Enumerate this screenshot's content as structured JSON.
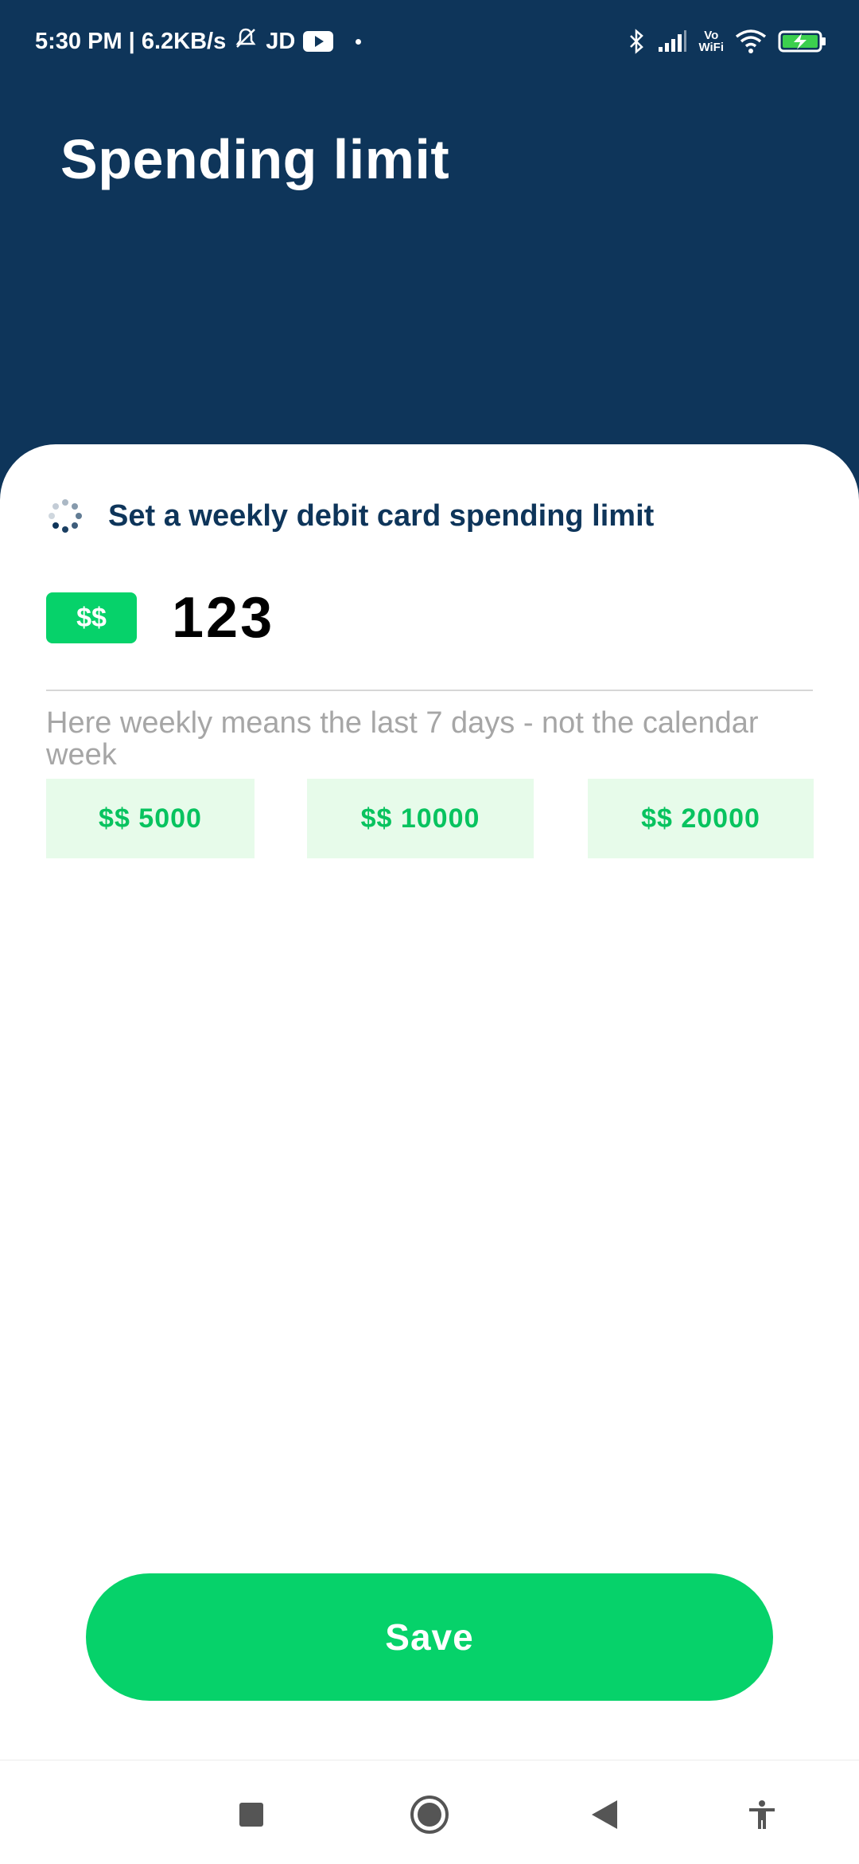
{
  "status_bar": {
    "time_and_speed": "5:30 PM | 6.2KB/s",
    "carrier_tag": "JD",
    "vowifi_top": "Vo",
    "vowifi_bottom": "WiFi"
  },
  "header": {
    "title": "Spending limit"
  },
  "card": {
    "heading": "Set a weekly debit card spending limit",
    "currency_badge": "$$",
    "amount_value": "123",
    "hint": "Here weekly means the last 7 days - not the calendar week",
    "presets": [
      {
        "label": "$$ 5000"
      },
      {
        "label": "$$ 10000"
      },
      {
        "label": "$$ 20000"
      }
    ]
  },
  "actions": {
    "save_label": "Save"
  },
  "colors": {
    "header_bg": "#0e355a",
    "accent_green": "#06d26a",
    "preset_bg": "#e7fbea",
    "hint_text": "#a6a6a6"
  },
  "icons": {
    "heading_icon": "loading-spinner-icon",
    "nav": [
      "recents-square-icon",
      "home-circle-icon",
      "back-triangle-icon",
      "accessibility-icon"
    ]
  }
}
